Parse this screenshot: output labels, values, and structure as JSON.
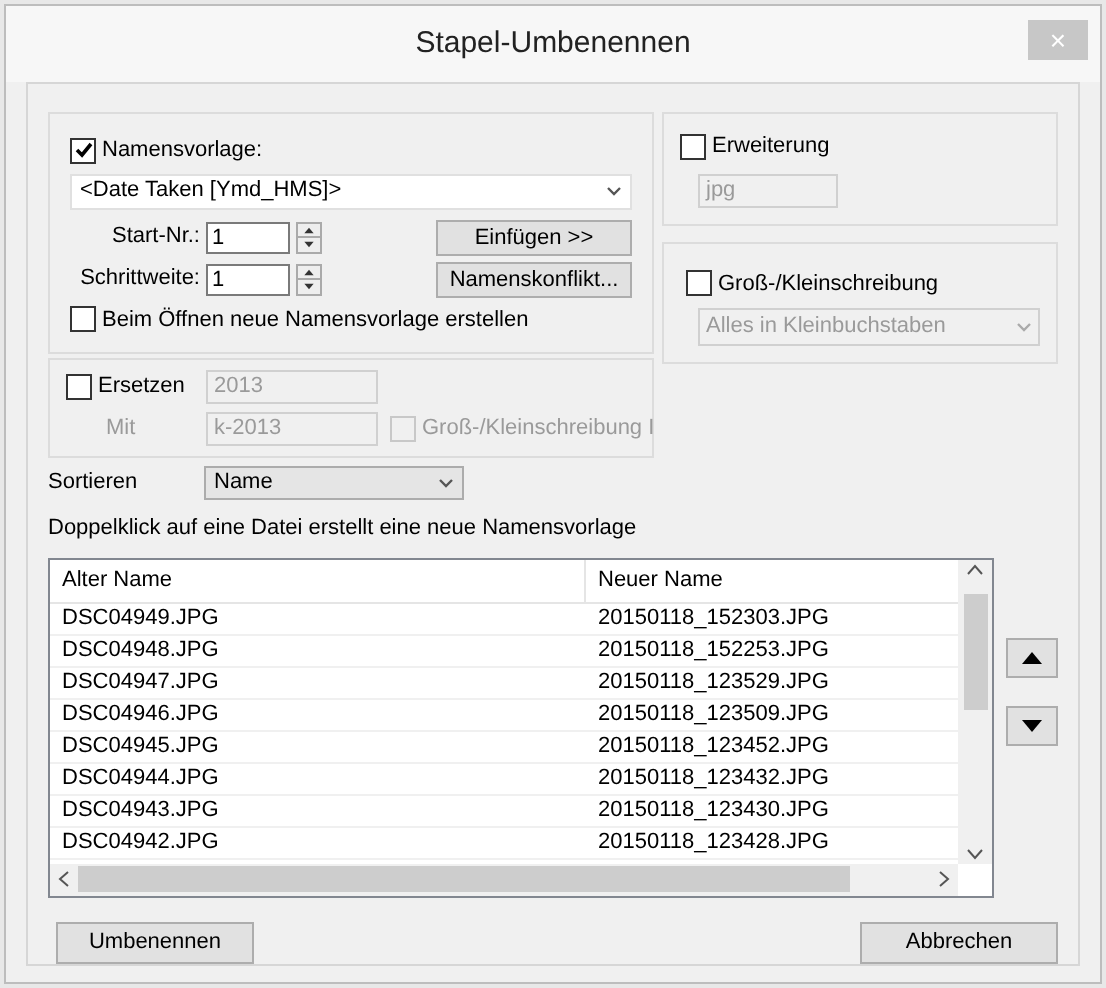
{
  "window": {
    "title": "Stapel-Umbenennen",
    "close": "×"
  },
  "template": {
    "label": "Namensvorlage:",
    "checked": true,
    "value": "<Date Taken [Ymd_HMS]>",
    "start": {
      "label": "Start-Nr.:",
      "value": "1"
    },
    "step": {
      "label": "Schrittweite:",
      "value": "1"
    },
    "insert_button": "Einfügen >>",
    "conflict_button": "Namenskonflikt...",
    "on_open": {
      "label": "Beim Öffnen neue Namensvorlage erstellen",
      "checked": false
    }
  },
  "replace": {
    "label": "Ersetzen",
    "checked": false,
    "find": "2013",
    "with_label": "Mit",
    "with": "k-2013",
    "case_label": "Groß-/Kleinschreibung I",
    "case_checked": false
  },
  "extension": {
    "label": "Erweiterung",
    "checked": false,
    "value": "jpg"
  },
  "case": {
    "label": "Groß-/Kleinschreibung",
    "checked": false,
    "value": "Alles in Kleinbuchstaben"
  },
  "sort": {
    "label": "Sortieren",
    "value": "Name"
  },
  "hint": "Doppelklick auf eine Datei erstellt eine neue Namensvorlage",
  "table": {
    "columns": [
      "Alter Name",
      "Neuer Name"
    ],
    "rows": [
      [
        "DSC04949.JPG",
        "20150118_152303.JPG"
      ],
      [
        "DSC04948.JPG",
        "20150118_152253.JPG"
      ],
      [
        "DSC04947.JPG",
        "20150118_123529.JPG"
      ],
      [
        "DSC04946.JPG",
        "20150118_123509.JPG"
      ],
      [
        "DSC04945.JPG",
        "20150118_123452.JPG"
      ],
      [
        "DSC04944.JPG",
        "20150118_123432.JPG"
      ],
      [
        "DSC04943.JPG",
        "20150118_123430.JPG"
      ],
      [
        "DSC04942.JPG",
        "20150118_123428.JPG"
      ]
    ]
  },
  "buttons": {
    "rename": "Umbenennen",
    "cancel": "Abbrechen"
  }
}
